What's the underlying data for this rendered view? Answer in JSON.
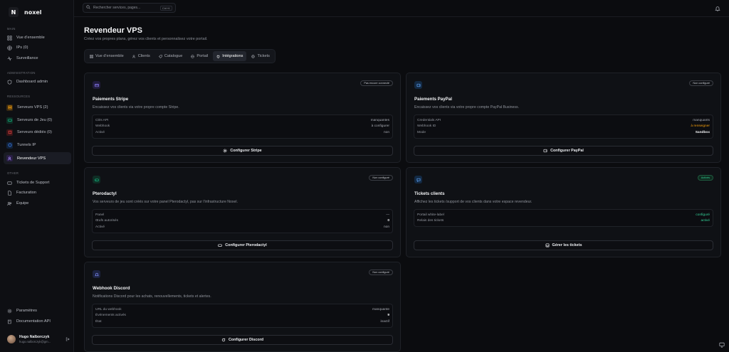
{
  "app": {
    "logo_letter": "N",
    "name": "noxel"
  },
  "sidebar": {
    "sections": {
      "main": "MAIN",
      "admin": "ADMINISTRATION",
      "resources": "RESSOURCES",
      "other": "OTHER"
    },
    "main_items": [
      {
        "label": "Vue d'ensemble"
      },
      {
        "label": "IPs (0)"
      },
      {
        "label": "Surveillance"
      }
    ],
    "admin_items": [
      {
        "label": "Dashboard admin"
      }
    ],
    "resource_items": [
      {
        "label": "Serveurs VPS (2)",
        "color": "#d97706"
      },
      {
        "label": "Serveurs de Jeu (0)",
        "color": "#10b981"
      },
      {
        "label": "Serveurs dédiés (0)",
        "color": "#ef4444"
      },
      {
        "label": "Tunnels IP",
        "color": "#3b82f6"
      },
      {
        "label": "Revendeur VPS",
        "color": "#8b5cf6"
      }
    ],
    "other_items": [
      {
        "label": "Tickets de Support"
      },
      {
        "label": "Facturation"
      },
      {
        "label": "Équipe"
      }
    ],
    "bottom_items": [
      {
        "label": "Paramètres"
      },
      {
        "label": "Documentation API"
      }
    ],
    "user": {
      "name": "Hugo Nalborczyk",
      "email": "hugo.nalborczyk@gm..."
    }
  },
  "topbar": {
    "search_placeholder": "Rechercher services, pages...",
    "shortcut": "Ctrl+K"
  },
  "page": {
    "title": "Revendeur VPS",
    "subtitle": "Créez vos propres plans, gérez vos clients et personnalisez votre portail."
  },
  "tabs": [
    {
      "label": "Vue d'ensemble"
    },
    {
      "label": "Clients"
    },
    {
      "label": "Catalogue"
    },
    {
      "label": "Portail"
    },
    {
      "label": "Intégrations"
    },
    {
      "label": "Tickets"
    }
  ],
  "cards": {
    "stripe": {
      "badge": "Pas encore connecté",
      "title": "Paiements Stripe",
      "desc": "Encaissez vos clients via votre propre compte Stripe.",
      "rows": [
        {
          "k": "Clés API",
          "v": "manquantes"
        },
        {
          "k": "Webhook",
          "v": "à configurer"
        },
        {
          "k": "Activé",
          "v": "non"
        }
      ],
      "button": "Configurer Stripe"
    },
    "paypal": {
      "badge": "Non configuré",
      "title": "Paiements PayPal",
      "desc": "Encaissez vos clients via votre propre compte PayPal Business.",
      "rows": [
        {
          "k": "Credentials API",
          "v": "manquants"
        },
        {
          "k": "Webhook ID",
          "v": "à renseigner"
        },
        {
          "k": "Mode",
          "v": "Sandbox"
        }
      ],
      "button": "Configurer PayPal"
    },
    "pterodactyl": {
      "badge": "Non configuré",
      "title": "Pterodactyl",
      "desc": "Vos serveurs de jeu sont créés sur votre panel Pterodactyl, pas sur l'infrastructure Noxel.",
      "rows": [
        {
          "k": "Panel",
          "v": "—"
        },
        {
          "k": "Œufs autorisés",
          "v": "0"
        },
        {
          "k": "Activé",
          "v": "non"
        }
      ],
      "button": "Configurer Pterodactyl"
    },
    "tickets": {
      "badge": "Activés",
      "title": "Tickets clients",
      "desc": "Affichez les tickets /support de vos clients dans votre espace revendeur.",
      "rows": [
        {
          "k": "Portail white-label",
          "v": "configuré"
        },
        {
          "k": "Relais des tickets",
          "v": "activé"
        }
      ],
      "button": "Gérer les tickets"
    },
    "discord": {
      "badge": "Non configuré",
      "title": "Webhook Discord",
      "desc": "Notifications Discord pour les achats, renouvellements, tickets et alertes.",
      "rows": [
        {
          "k": "URL du webhook",
          "v": "manquante"
        },
        {
          "k": "Événements activés",
          "v": "9"
        },
        {
          "k": "État",
          "v": "inactif"
        }
      ],
      "button": "Configurer Discord"
    }
  }
}
